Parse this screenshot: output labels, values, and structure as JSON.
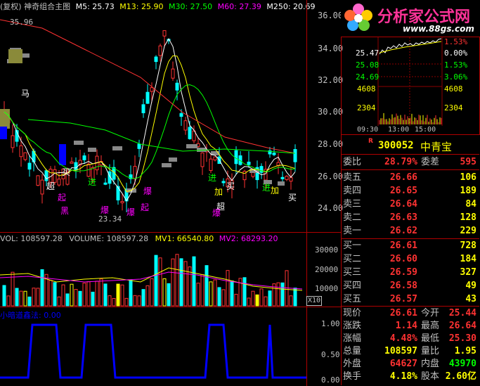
{
  "colors": {
    "up": "#ff3232",
    "down": "#00ffff",
    "ma5": "#ffffff",
    "ma13": "#ffff00",
    "ma30": "#00ff00",
    "ma60": "#ff00ff",
    "ma250": "#ffffff",
    "grid": "#8b0000",
    "flat": "#c0c0c0",
    "vol": "#ffffff"
  },
  "main_panel": {
    "title": "(复权) 神奇组合主图",
    "ma5": "M5: 25.73",
    "ma13": "M13: 25.90",
    "ma30": "M30: 27.50",
    "ma60": "M60: 27.39",
    "ma250": "M250: 20.69",
    "high_marker": "35.96",
    "low_marker": "23.34",
    "y_ticks": [
      "36.00",
      "34.00",
      "32.00",
      "30.00",
      "28.00",
      "26.00",
      "24.00"
    ],
    "signals": [
      {
        "text": "马",
        "color": "#ffffff"
      },
      {
        "text": "买",
        "color": "#ffffff"
      },
      {
        "text": "超",
        "color": "#ffffff"
      },
      {
        "text": "起",
        "color": "#ff00ff"
      },
      {
        "text": "黑",
        "color": "#ff00ff"
      },
      {
        "text": "进",
        "color": "#00ff00"
      },
      {
        "text": "爆",
        "color": "#ff00ff"
      },
      {
        "text": "爆",
        "color": "#ff00ff"
      },
      {
        "text": "起",
        "color": "#ff00ff"
      },
      {
        "text": "爆",
        "color": "#ff00ff"
      },
      {
        "text": "进",
        "color": "#00ff00"
      },
      {
        "text": "加",
        "color": "#ffff00"
      },
      {
        "text": "买",
        "color": "#ffffff"
      },
      {
        "text": "超",
        "color": "#ffffff"
      },
      {
        "text": "爆",
        "color": "#ff00ff"
      },
      {
        "text": "进",
        "color": "#00ff00"
      },
      {
        "text": "加",
        "color": "#ffff00"
      },
      {
        "text": "买",
        "color": "#ffffff"
      }
    ]
  },
  "volume_panel": {
    "vol": "VOL: 108597.28",
    "volume": "VOLUME: 108597.28",
    "mv1": "MV1: 66540.80",
    "mv2": "MV2: 68293.20",
    "y_ticks": [
      "30000",
      "20000",
      "10000"
    ],
    "unit": "X10"
  },
  "indicator_panel": {
    "title": "小暗道鑫法: 0.00",
    "y_ticks": [
      "1.00",
      "0.50",
      "0.00"
    ]
  },
  "logo": {
    "brand": "分析家公式网",
    "url": "www.88gs.com"
  },
  "mini_chart": {
    "price_left": [
      "25.47",
      "25.08",
      "24.69"
    ],
    "pct_right": [
      "1.53%",
      "0.00%",
      "1.53%",
      "3.06%"
    ],
    "top_right": "1.53%",
    "vol_left": [
      "4608",
      "2304"
    ],
    "vol_right": [
      "4608",
      "2304"
    ],
    "time_labels": [
      "09:30",
      "13:00",
      "15:00"
    ]
  },
  "quote": {
    "code": "300052",
    "name": "中青宝",
    "wb_label": "委比",
    "wb_value": "28.79%",
    "wc_label": "委差",
    "wc_value": "595",
    "asks": [
      {
        "label": "卖五",
        "price": "26.66",
        "vol": "106"
      },
      {
        "label": "卖四",
        "price": "26.65",
        "vol": "189"
      },
      {
        "label": "卖三",
        "price": "26.64",
        "vol": "84"
      },
      {
        "label": "卖二",
        "price": "26.63",
        "vol": "128"
      },
      {
        "label": "卖一",
        "price": "26.62",
        "vol": "229"
      }
    ],
    "bids": [
      {
        "label": "买一",
        "price": "26.61",
        "vol": "728"
      },
      {
        "label": "买二",
        "price": "26.60",
        "vol": "184"
      },
      {
        "label": "买三",
        "price": "26.59",
        "vol": "327"
      },
      {
        "label": "买四",
        "price": "26.58",
        "vol": "49"
      },
      {
        "label": "买五",
        "price": "26.57",
        "vol": "43"
      }
    ],
    "stats": [
      {
        "l1": "现价",
        "v1": "26.61",
        "c1": "#ff3232",
        "l2": "今开",
        "v2": "25.44",
        "c2": "#ff3232"
      },
      {
        "l1": "涨跌",
        "v1": "1.14",
        "c1": "#ff3232",
        "l2": "最高",
        "v2": "26.64",
        "c2": "#ff3232"
      },
      {
        "l1": "涨幅",
        "v1": "4.48%",
        "c1": "#ff3232",
        "l2": "最低",
        "v2": "25.30",
        "c2": "#ff3232"
      },
      {
        "l1": "总量",
        "v1": "108597",
        "c1": "#ffff00",
        "l2": "量比",
        "v2": "1.95",
        "c2": "#ffff00"
      },
      {
        "l1": "外盘",
        "v1": "64627",
        "c1": "#ff3232",
        "l2": "内盘",
        "v2": "43970",
        "c2": "#00ff00"
      },
      {
        "l1": "换手",
        "v1": "4.18%",
        "c1": "#ffff00",
        "l2": "股本",
        "v2": "2.60亿",
        "c2": "#ffff00"
      }
    ]
  }
}
